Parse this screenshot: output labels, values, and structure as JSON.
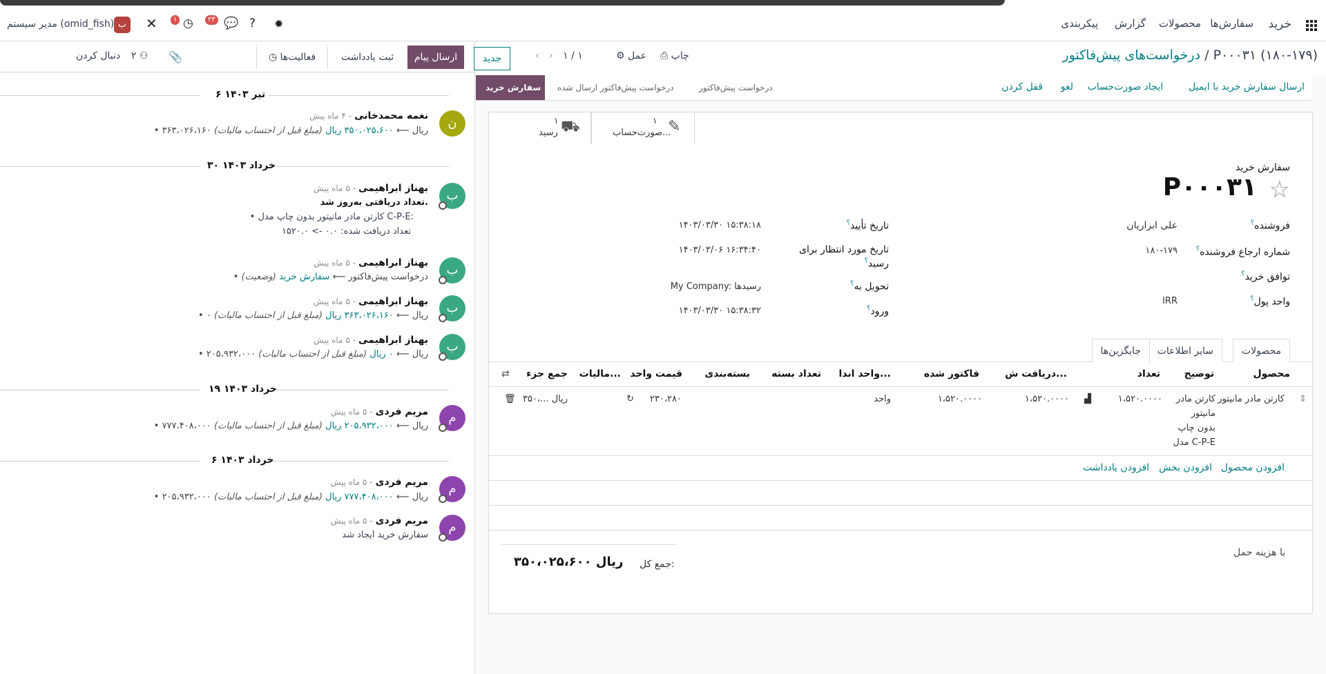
{
  "navbar": {
    "app_name": "خرید",
    "menu": [
      "سفارش‌ها",
      "محصولات",
      "گزارش",
      "پیکربندی"
    ],
    "messages_badge": "۲۳",
    "activities_badge": "۱",
    "user_initial": "ب",
    "user_name": "مدیر سیستم (omid_fish)"
  },
  "breadcrumb": {
    "parent": "درخواست‌های پیش‌فاکتور",
    "separator": "/",
    "current": "P۰۰۰۳۱ (۱۸۰-۱۷۹)"
  },
  "toolbar": {
    "print_label": "چاپ",
    "action_label": "عمل",
    "pager": "۱ / ۱",
    "new_label": "جدید"
  },
  "statusbar": {
    "buttons": [
      "ارسال سفارش خرید با ایمیل",
      "ایجاد صورت‌حساب",
      "لغو",
      "قفل کردن"
    ],
    "stages": [
      "درخواست پیش‌فاکتور",
      "درخواست پیش‌فاکتور ارسال شده",
      "سفارش خرید"
    ],
    "active_stage": "سفارش خرید"
  },
  "smart_buttons": [
    {
      "value": "۱",
      "label": "صورت‌حساب...",
      "icon": "pencil-square-icon"
    },
    {
      "value": "۱",
      "label": "رسید",
      "icon": "truck-icon"
    }
  ],
  "form": {
    "subtitle": "سفارش خرید",
    "name": "P۰۰۰۳۱",
    "vendor_label": "فروشنده",
    "vendor_value": "علی ابزاریان",
    "vendor_ref_label": "شماره ارجاع فروشنده",
    "vendor_ref_value": "۱۸۰-۱۷۹",
    "agreement_label": "توافق خرید",
    "currency_label": "واحد پول",
    "currency_value": "IRR",
    "confirm_date_label": "تاریخ تأیید",
    "confirm_date_value": "۱۴۰۳/۰۳/۳۰ ۱۵:۳۸:۱۸",
    "expected_label_1": "تاریخ مورد انتظار برای",
    "expected_label_2": "رسید",
    "expected_value": "۱۴۰۳/۰۳/۰۶ ۱۶:۳۴:۴۰",
    "deliver_label": "تحویل به",
    "deliver_value": "My Company: رسیدها",
    "arrival_label": "ورود",
    "arrival_value": "۱۴۰۳/۰۳/۳۰ ۱۵:۳۸:۳۲"
  },
  "tabs": [
    "محصولات",
    "سایر اطلاعات",
    "جایگزین‌ها"
  ],
  "lines": {
    "headers": [
      "محصول",
      "توضیح",
      "تعداد",
      "دریافت ش...",
      "فاکتور شده",
      "واحد اندا...",
      "تعداد بسته",
      "بسته‌بندی",
      "قیمت واحد",
      "مالیات...",
      "جمع جزء"
    ],
    "row": {
      "product": "کارتن مادر مانیتور",
      "description": [
        "کارتن مادر",
        "مانیتور",
        "بدون چاپ",
        "مدل C-P-E"
      ],
      "qty": "۱،۵۲۰.۰۰۰۰",
      "received": "۱،۵۲۰.۰۰۰۰",
      "invoiced": "۱،۵۲۰.۰۰۰۰",
      "uom": "واحد",
      "unit_price": "۲۳۰،۲۸۰",
      "subtotal": "۳۵۰،... ریال"
    },
    "add_links": [
      "افزودن محصول",
      "افزودن بخش",
      "افزودن یادداشت"
    ]
  },
  "footer": {
    "terms": "با هزینه حمل",
    "total_label": "جمع کل:",
    "total_value": "۳۵۰،۰۲۵،۶۰۰ ریال"
  },
  "chatter": {
    "send_message": "ارسال پیام",
    "log_note": "ثبت یادداشت",
    "activities": "فعالیت‌ها",
    "followers_count": "۲",
    "follow": "دنبال کردن",
    "dates": [
      "۶ تیر ۱۴۰۳",
      "۳۰ خرداد ۱۴۰۳",
      "۱۹ خرداد ۱۴۰۳",
      "۶ خرداد ۱۴۰۳"
    ],
    "messages": [
      {
        "initial": "ن",
        "color": "#a5a80f",
        "author": "نغمه محمدخانی",
        "when": "- ۴ ماه پیش",
        "old": "۳۶۳،۰۲۶،۱۶۰ ریال",
        "new": "۳۵۰،۰۲۵،۶۰۰ ریال",
        "note": "(مبلغ قبل از احتساب مالیات)"
      },
      {
        "initial": "ب",
        "color": "#3aa882",
        "author": "بهناز ابراهیمی",
        "when": "- ۵ ماه پیش",
        "title": "تعداد دریافتی به‌روز شد.",
        "bullet": "کارتن مادر مانیتور بدون چاپ مدل C-P-E:",
        "detail": "تعداد دریافت شده: ۰.۰ -> ۱۵۲۰.۰"
      },
      {
        "initial": "ب",
        "color": "#3aa882",
        "author": "بهناز ابراهیمی",
        "when": "- ۵ ماه پیش",
        "old": "درخواست پیش‌فاکتور",
        "new": "سفارش خرید",
        "note": "(وضعیت)"
      },
      {
        "initial": "ب",
        "color": "#3aa882",
        "author": "بهناز ابراهیمی",
        "when": "- ۵ ماه پیش",
        "old": "۰ ریال",
        "new": "۳۶۳،۰۲۶،۱۶۰ ریال",
        "note": "(مبلغ قبل از احتساب مالیات)"
      },
      {
        "initial": "ب",
        "color": "#3aa882",
        "author": "بهناز ابراهیمی",
        "when": "- ۵ ماه پیش",
        "old": "۲۰۵،۹۳۲،۰۰۰ ریال",
        "new": "۰ ریال",
        "note": "(مبلغ قبل از احتساب مالیات)"
      },
      {
        "initial": "م",
        "color": "#8e44ad",
        "author": "مریم فردی",
        "when": "- ۵ ماه پیش",
        "old": "۷۷۷،۴۰۸،۰۰۰ ریال",
        "new": "۲۰۵،۹۳۲،۰۰۰ ریال",
        "note": "(مبلغ قبل از احتساب مالیات)"
      },
      {
        "initial": "م",
        "color": "#8e44ad",
        "author": "مریم فردی",
        "when": "- ۵ ماه پیش",
        "old": "۲۰۵،۹۳۲،۰۰۰ ریال",
        "new": "۷۷۷،۴۰۸،۰۰۰ ریال",
        "note": "(مبلغ قبل از احتساب مالیات)"
      },
      {
        "initial": "م",
        "color": "#8e44ad",
        "author": "مریم فردی",
        "when": "- ۵ ماه پیش",
        "body": "سفارش خرید ایجاد شد"
      }
    ]
  }
}
